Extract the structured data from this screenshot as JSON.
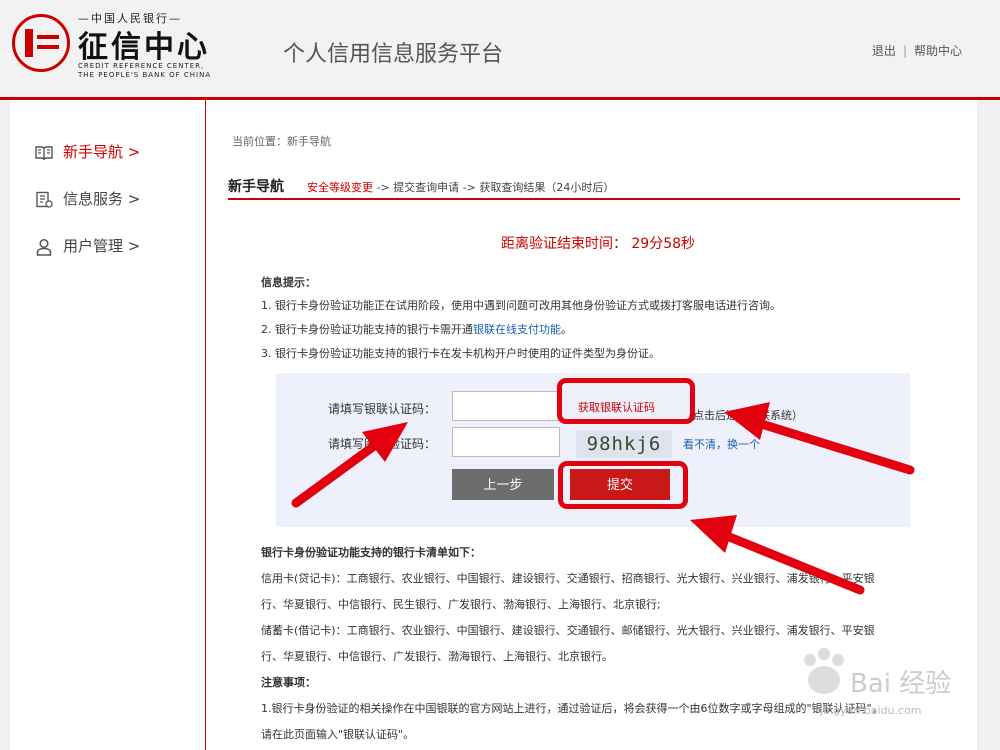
{
  "logo": {
    "top_text": "—中国人民银行—",
    "main_text": "征信中心",
    "en_line1": "CREDIT REFERENCE CENTER,",
    "en_line2": "THE PEOPLE'S BANK OF CHINA"
  },
  "header": {
    "platform_title": "个人信用信息服务平台",
    "logout": "退出",
    "separator": "|",
    "help": "帮助中心"
  },
  "sidebar": {
    "items": [
      {
        "label": "新手导航 >",
        "icon": "book-icon",
        "active": true
      },
      {
        "label": "信息服务 >",
        "icon": "document-icon",
        "active": false
      },
      {
        "label": "用户管理 >",
        "icon": "user-icon",
        "active": false
      }
    ]
  },
  "breadcrumb": "当前位置：新手导航",
  "guide": {
    "title": "新手导航",
    "step_current": "安全等级变更",
    "step_rest": " -> 提交查询申请 -> 获取查询结果（24小时后）"
  },
  "countdown": "距离验证结束时间： 29分58秒",
  "info": {
    "title": "信息提示：",
    "line1": "1. 银行卡身份验证功能正在试用阶段，使用中遇到问题可改用其他身份验证方式或拨打客服电话进行咨询。",
    "line2_prefix": "2. 银行卡身份验证功能支持的银行卡需开通",
    "line2_link": "银联在线支付功能",
    "line2_suffix": "。",
    "line3": "3. 银行卡身份验证功能支持的银行卡在发卡机构开户时使用的证件类型为身份证。"
  },
  "form": {
    "unionpay_label": "请填写银联认证码：",
    "unionpay_value": "",
    "get_code": "获取银联认证码",
    "get_code_hint": "（点击后进入银联系统）",
    "captcha_label": "请填写图片验证码：",
    "captcha_value": "",
    "captcha_text": "98hkj6",
    "refresh": "看不清，换一个",
    "prev_button": "上一步",
    "submit_button": "提交"
  },
  "banks": {
    "title": "银行卡身份验证功能支持的银行卡清单如下：",
    "credit_line1": "信用卡(贷记卡)：工商银行、农业银行、中国银行、建设银行、交通银行、招商银行、光大银行、兴业银行、浦发银行、平安银",
    "credit_line2": "行、华夏银行、中信银行、民生银行、广发银行、渤海银行、上海银行、北京银行;",
    "debit_line1": "储蓄卡(借记卡)：工商银行、农业银行、中国银行、建设银行、交通银行、邮储银行、光大银行、兴业银行、浦发银行、平安银",
    "debit_line2": "行、华夏银行、中信银行、广发银行、渤海银行、上海银行、北京银行。",
    "notice_title": "注意事项：",
    "notice_line1": "1.银行卡身份验证的相关操作在中国银联的官方网站上进行，通过验证后，将会获得一个由6位数字或字母组成的\"银联认证码\"，",
    "notice_line2": "请在此页面输入\"银联认证码\"。"
  },
  "watermark": {
    "text": "Bai 经验",
    "sub": "jingyan.baidu.com"
  },
  "colors": {
    "accent": "#cc0000",
    "link": "#1a5fb4",
    "highlight": "#e3000f"
  }
}
